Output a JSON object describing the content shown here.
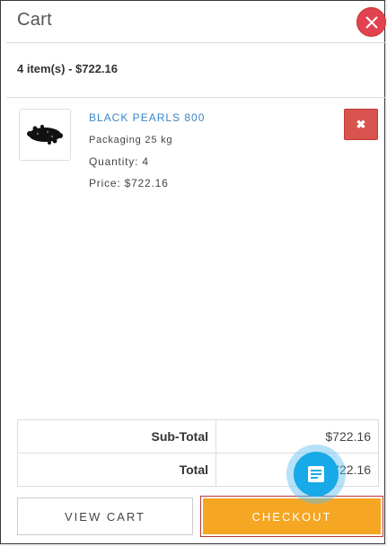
{
  "cart": {
    "title": "Cart",
    "summary": "4 item(s) - $722.16"
  },
  "item": {
    "name": "BLACK PEARLS 800",
    "packaging": "Packaging 25 kg",
    "quantity": "Quantity: 4",
    "price": "Price: $722.16"
  },
  "totals": [
    {
      "label": "Sub-Total",
      "value": "$722.16"
    },
    {
      "label": "Total",
      "value": "$722.16"
    }
  ],
  "buttons": {
    "view_cart": "VIEW CART",
    "checkout": "CHECKOUT"
  },
  "icons": {
    "close": "close-icon",
    "remove": "remove-icon",
    "chat": "chat-icon"
  },
  "colors": {
    "close": "#e0424f",
    "remove": "#d9534f",
    "link": "#3a85c6",
    "checkout": "#f5a623",
    "chat": "#18a9e8"
  }
}
